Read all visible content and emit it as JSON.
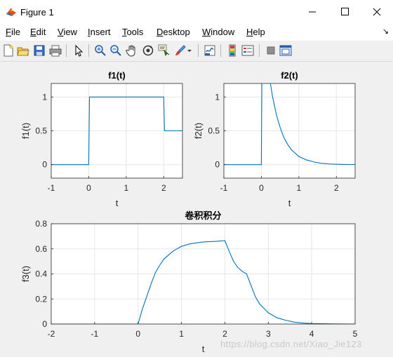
{
  "window": {
    "title": "Figure 1",
    "controls": [
      "minimize",
      "maximize",
      "close"
    ]
  },
  "menubar": {
    "items": [
      {
        "label": "File",
        "mnemonic": "F",
        "rest": "ile"
      },
      {
        "label": "Edit",
        "mnemonic": "E",
        "rest": "dit"
      },
      {
        "label": "View",
        "mnemonic": "V",
        "rest": "iew"
      },
      {
        "label": "Insert",
        "mnemonic": "I",
        "rest": "nsert"
      },
      {
        "label": "Tools",
        "mnemonic": "T",
        "rest": "ools"
      },
      {
        "label": "Desktop",
        "mnemonic": "D",
        "rest": "esktop"
      },
      {
        "label": "Window",
        "mnemonic": "W",
        "rest": "indow"
      },
      {
        "label": "Help",
        "mnemonic": "H",
        "rest": "elp"
      }
    ],
    "overflow_glyph": "↘"
  },
  "toolbar": {
    "icons": [
      "new-figure-icon",
      "open-file-icon",
      "save-icon",
      "print-icon",
      "pointer-icon",
      "zoom-in-icon",
      "zoom-out-icon",
      "pan-hand-icon",
      "rotate-3d-icon",
      "data-cursor-icon",
      "brush-icon",
      "link-plot-icon",
      "colorbar-icon",
      "legend-icon",
      "hide-plot-tools-icon",
      "show-plot-tools-icon"
    ]
  },
  "colors": {
    "line": "#0072bd",
    "axes_bg": "#ffffff",
    "figure_bg": "#f0f0f0",
    "grid": "#e6e6e6"
  },
  "chart_data": [
    {
      "type": "line",
      "title": "f1(t)",
      "xlabel": "t",
      "ylabel": "f1(t)",
      "xlim": [
        -1,
        2.5
      ],
      "ylim": [
        -0.2,
        1.2
      ],
      "xticks": [
        -1,
        0,
        1,
        2
      ],
      "yticks": [
        0,
        0.5,
        1
      ],
      "grid": true,
      "series": [
        {
          "x": [
            -1,
            0,
            0.02,
            2,
            2.02,
            2.5
          ],
          "y": [
            0,
            0,
            1,
            1,
            0.5,
            0.5
          ]
        }
      ]
    },
    {
      "type": "line",
      "title": "f2(t)",
      "xlabel": "t",
      "ylabel": "f2(t)",
      "xlim": [
        -1,
        2.5
      ],
      "ylim": [
        -0.2,
        1.2
      ],
      "xticks": [
        -1,
        0,
        1,
        2
      ],
      "yticks": [
        0,
        0.5,
        1
      ],
      "grid": true,
      "series": [
        {
          "x": [
            -1,
            0,
            0.02,
            0.1,
            0.2,
            0.3,
            0.4,
            0.5,
            0.6,
            0.7,
            0.8,
            1.0,
            1.2,
            1.4,
            1.6,
            1.8,
            2.0,
            2.2,
            2.5
          ],
          "y": [
            0,
            0,
            2.0,
            1.81,
            1.34,
            1.0,
            0.74,
            0.55,
            0.4,
            0.3,
            0.22,
            0.12,
            0.07,
            0.04,
            0.02,
            0.01,
            0.006,
            0.003,
            0.001
          ]
        }
      ]
    },
    {
      "type": "line",
      "title": "卷积积分",
      "xlabel": "t",
      "ylabel": "f3(t)",
      "xlim": [
        -2,
        5
      ],
      "ylim": [
        0,
        0.8
      ],
      "xticks": [
        -2,
        -1,
        0,
        1,
        2,
        3,
        4,
        5
      ],
      "yticks": [
        0,
        0.2,
        0.4,
        0.6,
        0.8
      ],
      "grid": true,
      "series": [
        {
          "x": [
            -2,
            0,
            0.1,
            0.2,
            0.3,
            0.4,
            0.5,
            0.6,
            0.8,
            1.0,
            1.2,
            1.5,
            1.8,
            2.0,
            2.1,
            2.2,
            2.3,
            2.4,
            2.5,
            2.6,
            2.7,
            2.8,
            3.0,
            3.2,
            3.4,
            3.6,
            3.8,
            4.0,
            4.5,
            5.0
          ],
          "y": [
            0,
            0,
            0.12,
            0.22,
            0.32,
            0.41,
            0.47,
            0.52,
            0.58,
            0.62,
            0.64,
            0.655,
            0.66,
            0.665,
            0.58,
            0.5,
            0.45,
            0.42,
            0.4,
            0.31,
            0.22,
            0.16,
            0.09,
            0.05,
            0.03,
            0.015,
            0.008,
            0.004,
            0.001,
            0.0
          ]
        }
      ]
    }
  ],
  "watermark": "https://blog.csdn.net/Xiao_Jie123"
}
